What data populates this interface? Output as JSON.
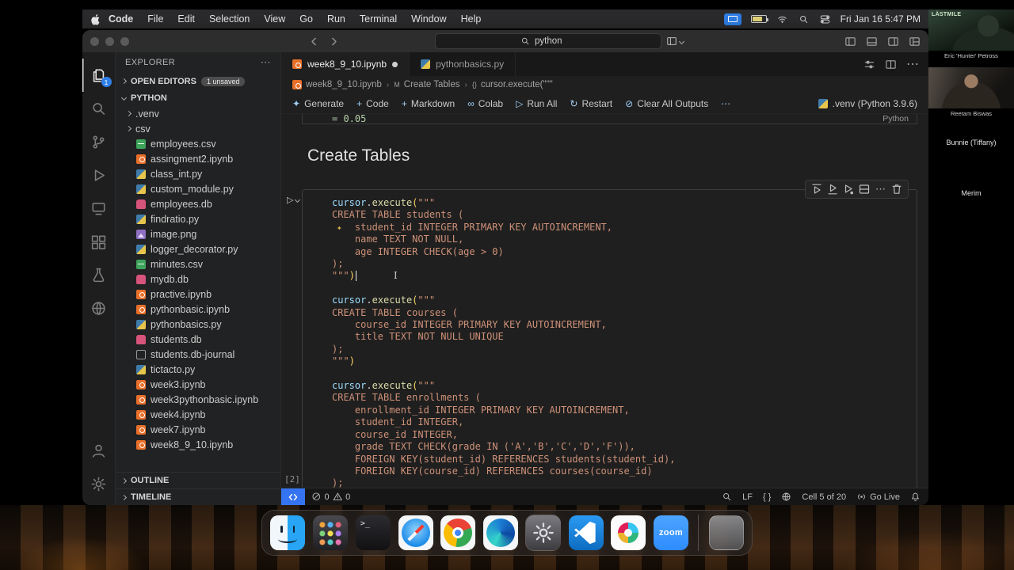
{
  "menubar": {
    "app_name": "Code",
    "items": [
      "File",
      "Edit",
      "Selection",
      "View",
      "Go",
      "Run",
      "Terminal",
      "Window",
      "Help"
    ],
    "clock": "Fri Jan 16 5:47 PM",
    "status_icons": [
      "screen-mirroring-icon",
      "battery-icon",
      "wifi-icon",
      "spotlight-icon",
      "control-center-icon"
    ]
  },
  "titlebar": {
    "search_value": "python"
  },
  "tabs": [
    {
      "label": "week8_9_10.ipynb",
      "icon": "ipynb-icon",
      "dirty": true,
      "active": true
    },
    {
      "label": "pythonbasics.py",
      "icon": "python-icon",
      "dirty": false,
      "active": false
    }
  ],
  "breadcrumb": [
    {
      "label": "week8_9_10.ipynb",
      "icon": "ipynb-icon"
    },
    {
      "label": "Create Tables",
      "icon": "markdown-icon"
    },
    {
      "label": "cursor.execute(\"\"\"",
      "icon": "symbol-icon"
    }
  ],
  "explorer": {
    "title": "EXPLORER",
    "more": "⋯",
    "sections": {
      "open_editors": {
        "label": "OPEN EDITORS",
        "badge": "1 unsaved"
      },
      "project": {
        "label": "PYTHON"
      },
      "outline": {
        "label": "OUTLINE"
      },
      "timeline": {
        "label": "TIMELINE"
      }
    },
    "files": [
      {
        "name": ".venv",
        "kind": "folder"
      },
      {
        "name": "csv",
        "kind": "folder"
      },
      {
        "name": "employees.csv",
        "kind": "csv"
      },
      {
        "name": "assingment2.ipynb",
        "kind": "ipynb"
      },
      {
        "name": "class_int.py",
        "kind": "py"
      },
      {
        "name": "custom_module.py",
        "kind": "py"
      },
      {
        "name": "employees.db",
        "kind": "db"
      },
      {
        "name": "findratio.py",
        "kind": "py"
      },
      {
        "name": "image.png",
        "kind": "png"
      },
      {
        "name": "logger_decorator.py",
        "kind": "py"
      },
      {
        "name": "minutes.csv",
        "kind": "csv"
      },
      {
        "name": "mydb.db",
        "kind": "db"
      },
      {
        "name": "practive.ipynb",
        "kind": "ipynb"
      },
      {
        "name": "pythonbasic.ipynb",
        "kind": "ipynb"
      },
      {
        "name": "pythonbasics.py",
        "kind": "py"
      },
      {
        "name": "students.db",
        "kind": "db"
      },
      {
        "name": "students.db-journal",
        "kind": "file"
      },
      {
        "name": "tictacto.py",
        "kind": "py"
      },
      {
        "name": "week3.ipynb",
        "kind": "ipynb"
      },
      {
        "name": "week3pythonbasic.ipynb",
        "kind": "ipynb"
      },
      {
        "name": "week4.ipynb",
        "kind": "ipynb"
      },
      {
        "name": "week7.ipynb",
        "kind": "ipynb"
      },
      {
        "name": "week8_9_10.ipynb",
        "kind": "ipynb"
      }
    ]
  },
  "notebook": {
    "toolbar": {
      "items": [
        {
          "icon": "sparkle-icon",
          "label": "Generate"
        },
        {
          "icon": "plus-icon",
          "label": "Code"
        },
        {
          "icon": "plus-icon",
          "label": "Markdown"
        },
        {
          "icon": "colab-icon",
          "label": "Colab"
        },
        {
          "icon": "run-all-icon",
          "label": "Run All"
        },
        {
          "icon": "restart-icon",
          "label": "Restart"
        },
        {
          "icon": "clear-icon",
          "label": "Clear All Outputs"
        },
        {
          "icon": "more-icon",
          "label": ""
        }
      ],
      "kernel": ".venv (Python 3.9.6)"
    },
    "partial_top_line": "= 0.05",
    "partial_lang": "Python",
    "heading": "Create Tables",
    "cell": {
      "exec_label": "[2]",
      "toolbar_icons": [
        "run-above-icon",
        "run-below-icon",
        "debug-cell-icon",
        "split-cell-icon",
        "more-icon",
        "trash-icon"
      ],
      "code_lines": [
        "cursor.execute(\"\"\"",
        "CREATE TABLE students (",
        "    student_id INTEGER PRIMARY KEY AUTOINCREMENT,",
        "    name TEXT NOT NULL,",
        "    age INTEGER CHECK(age > 0)",
        ");",
        "\"\"\")",
        "",
        "cursor.execute(\"\"\"",
        "CREATE TABLE courses (",
        "    course_id INTEGER PRIMARY KEY AUTOINCREMENT,",
        "    title TEXT NOT NULL UNIQUE",
        ");",
        "\"\"\")",
        "",
        "cursor.execute(\"\"\"",
        "CREATE TABLE enrollments (",
        "    enrollment_id INTEGER PRIMARY KEY AUTOINCREMENT,",
        "    student_id INTEGER,",
        "    course_id INTEGER,",
        "    grade TEXT CHECK(grade IN ('A','B','C','D','F')),",
        "    FOREIGN KEY(student_id) REFERENCES students(student_id),",
        "    FOREIGN KEY(course_id) REFERENCES courses(course_id)",
        ");"
      ]
    }
  },
  "statusbar": {
    "errors": "0",
    "warnings": "0",
    "right_items": [
      {
        "icon": "zoom-icon",
        "label": ""
      },
      {
        "icon": "",
        "label": "LF"
      },
      {
        "icon": "",
        "label": "{ }"
      },
      {
        "icon": "globe-icon",
        "label": ""
      },
      {
        "icon": "",
        "label": "Cell 5 of 20"
      },
      {
        "icon": "broadcast-icon",
        "label": "Go Live"
      },
      {
        "icon": "bell-icon",
        "label": ""
      }
    ]
  },
  "video_panel": {
    "participants": [
      {
        "name": "Eric 'Hunter' Petross",
        "video": true,
        "overlay": "LÄSTMILE",
        "style": "eric"
      },
      {
        "name": "Reetam Biswas",
        "video": true,
        "overlay": "",
        "style": "reetam"
      },
      {
        "name": "Bunnie (Tiffany)",
        "video": false
      },
      {
        "name": "Merim",
        "video": false
      }
    ]
  },
  "dock": {
    "apps": [
      "finder",
      "launchpad",
      "terminal",
      "safari",
      "chrome",
      "edge",
      "settings",
      "vscode",
      "slack",
      "zoom",
      "trash"
    ],
    "highlighted": "settings",
    "zoom_label": "zoom",
    "terminal_glyph": ">_"
  }
}
